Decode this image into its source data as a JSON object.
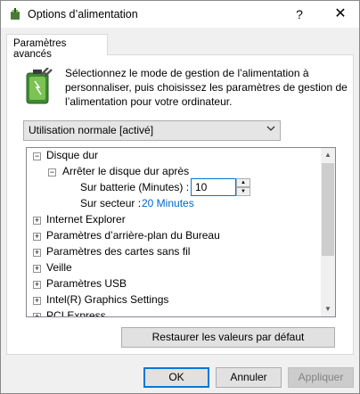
{
  "window": {
    "title": "Options d’alimentation",
    "help": "?",
    "close": "✕"
  },
  "tab": {
    "label": "Paramètres avancés"
  },
  "description": "Sélectionnez le mode de gestion de l’alimentation à personnaliser, puis choisissez les paramètres de gestion de l’alimentation pour votre ordinateur.",
  "plan_select": {
    "value": "Utilisation normale [activé]"
  },
  "tree": {
    "disk": "Disque dur",
    "disk_after": "Arrêter le disque dur après",
    "battery_label": "Sur batterie (Minutes) :",
    "battery_value": "10",
    "ac_label": "Sur secteur :",
    "ac_value": "20 Minutes",
    "items": [
      "Internet Explorer",
      "Paramètres d’arrière-plan du Bureau",
      "Paramètres des cartes sans fil",
      "Veille",
      "Paramètres USB",
      "Intel(R) Graphics Settings",
      "PCI Express"
    ]
  },
  "buttons": {
    "restore": "Restaurer les valeurs par défaut",
    "ok": "OK",
    "cancel": "Annuler",
    "apply": "Appliquer"
  }
}
